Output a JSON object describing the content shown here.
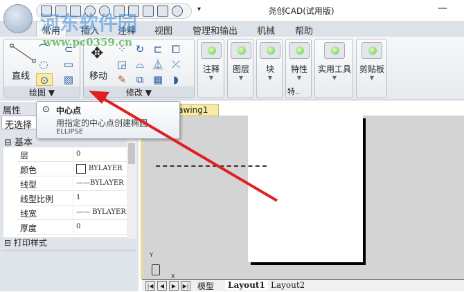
{
  "window": {
    "title": "尧创CAD(试用版)",
    "minimize": "—"
  },
  "watermark": {
    "name": "河东软件园",
    "url": "www.pc0359.cn"
  },
  "menu": [
    "常用",
    "插入",
    "注释",
    "视图",
    "管理和输出",
    "机械",
    "帮助"
  ],
  "ribbon": {
    "draw": {
      "line": "直线",
      "label": "绘图 ▼"
    },
    "modify": {
      "move": "移动",
      "label": "修改 ▼"
    },
    "panels": [
      "注释",
      "图层",
      "块",
      "特性",
      "实用工具",
      "剪贴板"
    ],
    "props_footer": "特.."
  },
  "tooltip": {
    "title": "中心点",
    "desc": "用指定的中心点创建椭圆.",
    "cmd": "ELLIPSE"
  },
  "left": {
    "header": "属性",
    "selection": "无选择",
    "section_basic": "基本",
    "section_print": "打印样式",
    "rows": [
      {
        "k": "层",
        "v": "0"
      },
      {
        "k": "颜色",
        "v": "BYLAYER"
      },
      {
        "k": "线型",
        "v": "BYLAYER"
      },
      {
        "k": "线型比例",
        "v": "1"
      },
      {
        "k": "线宽",
        "v": "BYLAYER"
      },
      {
        "k": "厚度",
        "v": "0"
      }
    ]
  },
  "doc_tab": "Drawing1",
  "ucs": {
    "x": "X",
    "y": "Y"
  },
  "layout_tabs": [
    "模型",
    "Layout1",
    "Layout2"
  ]
}
